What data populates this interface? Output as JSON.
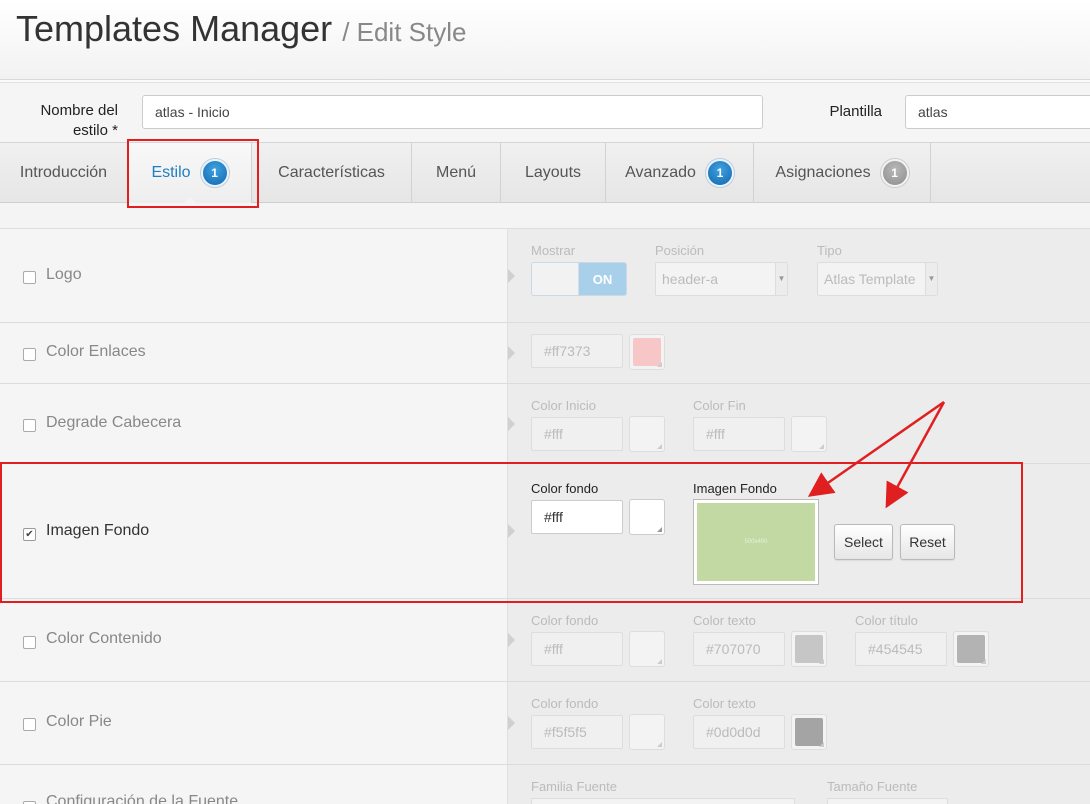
{
  "header": {
    "title": "Templates Manager",
    "subtitle": "/ Edit Style"
  },
  "name_bar": {
    "style_name_label": "Nombre del estilo *",
    "style_name_value": "atlas - Inicio",
    "template_label": "Plantilla",
    "template_value": "atlas"
  },
  "tabs": [
    {
      "label": "Introducción"
    },
    {
      "label": "Estilo",
      "badge": "1",
      "active": true
    },
    {
      "label": "Características"
    },
    {
      "label": "Menú"
    },
    {
      "label": "Layouts"
    },
    {
      "label": "Avanzado",
      "badge": "1"
    },
    {
      "label": "Asignaciones",
      "badge": "1"
    }
  ],
  "rows": {
    "logo": {
      "label": "Logo",
      "checked": false,
      "mostrar_label": "Mostrar",
      "toggle_value": "ON",
      "posicion_label": "Posición",
      "posicion_value": "header-a",
      "tipo_label": "Tipo",
      "tipo_value": "Atlas Template"
    },
    "color_enlaces": {
      "label": "Color Enlaces",
      "checked": false,
      "value": "#ff7373",
      "swatch": "#f7c6c6"
    },
    "degrade_cabecera": {
      "label": "Degrade Cabecera",
      "checked": false,
      "color_inicio_label": "Color Inicio",
      "color_inicio_value": "#fff",
      "color_fin_label": "Color Fin",
      "color_fin_value": "#fff"
    },
    "imagen_fondo": {
      "label": "Imagen Fondo",
      "checked": true,
      "check_glyph": "✔",
      "color_fondo_label": "Color fondo",
      "color_fondo_value": "#fff",
      "imagen_label": "Imagen Fondo",
      "image_caption": "500x400",
      "image_color": "#c2d9a3",
      "select_label": "Select",
      "reset_label": "Reset"
    },
    "color_contenido": {
      "label": "Color Contenido",
      "checked": false,
      "color_fondo_label": "Color fondo",
      "color_fondo_value": "#fff",
      "color_texto_label": "Color texto",
      "color_texto_value": "#707070",
      "color_texto_swatch": "#c6c6c6",
      "color_titulo_label": "Color título",
      "color_titulo_value": "#454545",
      "color_titulo_swatch": "#b3b3b3"
    },
    "color_pie": {
      "label": "Color Pie",
      "checked": false,
      "color_fondo_label": "Color fondo",
      "color_fondo_value": "#f5f5f5",
      "color_texto_label": "Color texto",
      "color_texto_value": "#0d0d0d",
      "color_texto_swatch": "#a4a4a4"
    },
    "fuente": {
      "label": "Configuración de la Fuente",
      "familia_label": "Familia Fuente",
      "tamano_label": "Tamaño Fuente"
    }
  },
  "colors": {
    "accent": "#1e7fc0",
    "highlight": "#e02020"
  }
}
